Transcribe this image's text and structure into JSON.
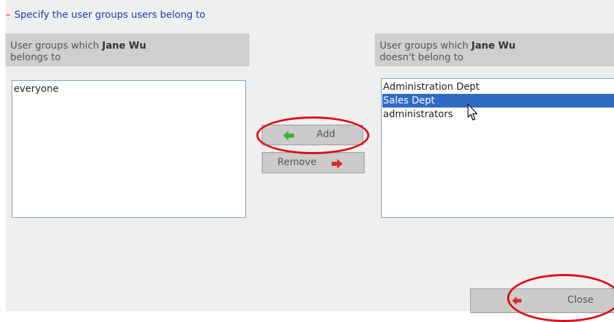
{
  "section": {
    "title": "Specify the user groups users belong to"
  },
  "left": {
    "header_prefix": "User groups which ",
    "user_name": "Jane Wu",
    "header_suffix": "belongs to",
    "items": [
      "everyone"
    ]
  },
  "right": {
    "header_prefix": "User groups which ",
    "user_name": "Jane Wu",
    "header_suffix": "doesn't belong to",
    "items": [
      "Administration Dept",
      "Sales Dept",
      "administrators"
    ],
    "selected_index": 1
  },
  "buttons": {
    "add_label": "Add",
    "remove_label": "Remove",
    "close_label": "Close"
  },
  "colors": {
    "selection": "#316ac5",
    "add_arrow": "#3cb43c",
    "remove_arrow": "#d92b2b",
    "highlight_circle": "#e30613",
    "title_text": "#1a3fb0"
  },
  "icons": {
    "add": "left-arrow-icon",
    "remove": "right-arrow-icon",
    "close": "left-arrow-icon",
    "pointer": "mouse-pointer-icon"
  }
}
